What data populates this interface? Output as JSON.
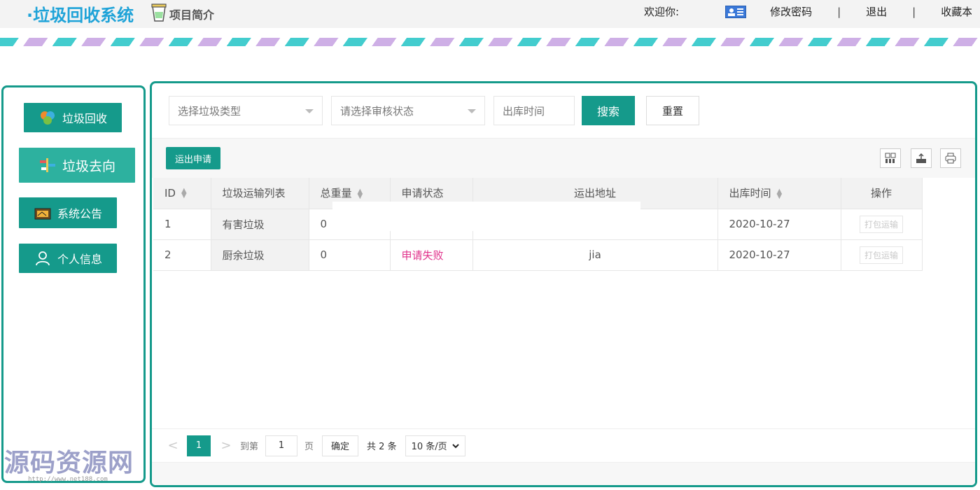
{
  "header": {
    "logo": "·垃圾回收系统",
    "intro": "项目简介",
    "welcome": "欢迎你:",
    "change_password": "修改密码",
    "sep1": "|",
    "logout": "退出",
    "sep2": "|",
    "favorite": "收藏本"
  },
  "sidebar": {
    "items": [
      {
        "label": "垃圾回收",
        "icon": "recycle-icon"
      },
      {
        "label": "垃圾去向",
        "icon": "direction-icon"
      },
      {
        "label": "系统公告",
        "icon": "notice-icon"
      },
      {
        "label": "个人信息",
        "icon": "user-icon"
      }
    ]
  },
  "search": {
    "type_placeholder": "选择垃圾类型",
    "status_placeholder": "请选择审核状态",
    "time_placeholder": "出库时间",
    "search_label": "搜索",
    "reset_label": "重置"
  },
  "toolbar": {
    "apply_label": "运出申请"
  },
  "table": {
    "columns": [
      "ID",
      "垃圾运输列表",
      "总重量",
      "申请状态",
      "运出地址",
      "出库时间",
      "操作"
    ],
    "rows": [
      {
        "id": "1",
        "name": "有害垃圾",
        "weight": "0",
        "status": "",
        "address": "",
        "time": "2020-10-27",
        "action": "打包运输"
      },
      {
        "id": "2",
        "name": "厨余垃圾",
        "weight": "0",
        "status": "申请失败",
        "address": "jia",
        "time": "2020-10-27",
        "action": "打包运输"
      }
    ]
  },
  "pager": {
    "prev": "<",
    "current": "1",
    "next": ">",
    "goto_label": "到第",
    "goto_value": "1",
    "page_label": "页",
    "ok_label": "确定",
    "total": "共 2 条",
    "page_size": "10 条/页"
  },
  "watermark": {
    "text": "源码资源网",
    "url": "http://www.net188.com"
  },
  "colors": {
    "accent": "#159a8b",
    "logo": "#1fa3d8",
    "fail": "#e0308a"
  }
}
